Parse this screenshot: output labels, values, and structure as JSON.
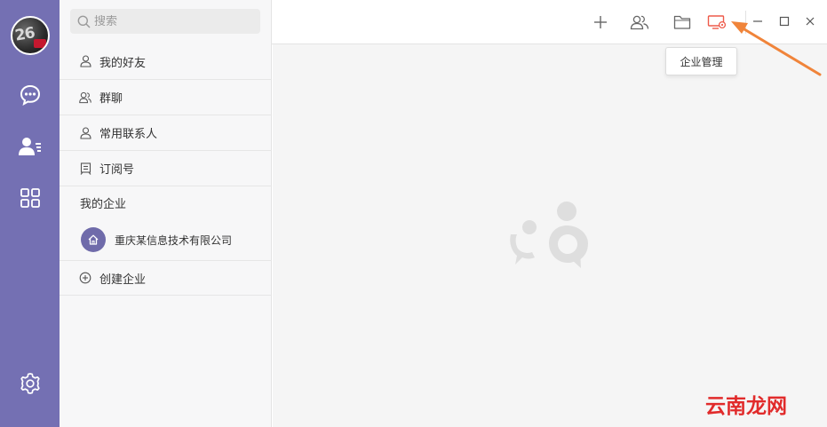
{
  "search": {
    "placeholder": "搜索"
  },
  "contacts": {
    "items": [
      {
        "label": "我的好友",
        "icon": "person-icon"
      },
      {
        "label": "群聊",
        "icon": "group-icon"
      },
      {
        "label": "常用联系人",
        "icon": "person-icon"
      },
      {
        "label": "订阅号",
        "icon": "subscription-icon"
      }
    ],
    "enterprise_section": "我的企业",
    "enterprise_name": "重庆某信息技术有限公司",
    "create_enterprise": "创建企业"
  },
  "toolbar": {
    "tooltip": "企业管理",
    "icons": [
      "plus-icon",
      "contacts-icon",
      "folder-icon",
      "enterprise-manage-icon"
    ]
  },
  "window_controls": [
    "minimize-icon",
    "maximize-icon",
    "close-icon"
  ],
  "sidebar": {
    "icons": [
      "chat-icon",
      "contacts-card-icon",
      "apps-grid-icon",
      "settings-icon"
    ]
  },
  "avatar": {
    "text": "26"
  },
  "watermark": "云南龙网",
  "colors": {
    "rail": "#7470b3",
    "accent_orange": "#f0843a",
    "enterprise_icon": "#ee5a4a",
    "watermark": "#e12b2b"
  }
}
